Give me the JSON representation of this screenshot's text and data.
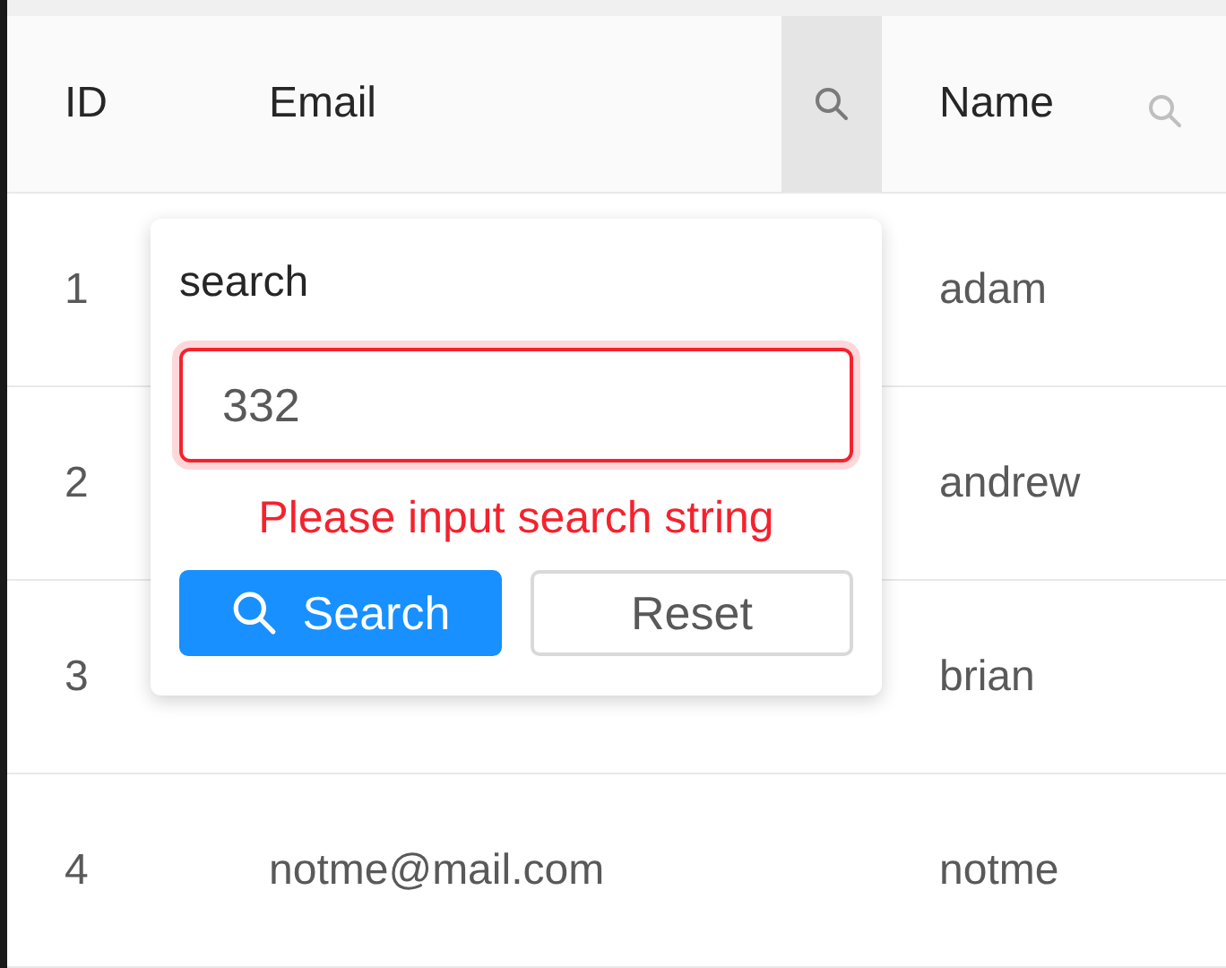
{
  "columns": [
    {
      "label": "ID"
    },
    {
      "label": "Email",
      "filter_active": true
    },
    {
      "label": "Name",
      "filter_active": false
    }
  ],
  "rows": [
    {
      "id": "1",
      "name": "adam"
    },
    {
      "id": "2",
      "name": "andrew"
    },
    {
      "id": "3",
      "name": "brian"
    },
    {
      "id": "4",
      "email": "notme@mail.com",
      "name": "notme"
    }
  ],
  "filter_popup": {
    "label": "search",
    "value": "332",
    "error": "Please input search string",
    "buttons": [
      {
        "label": "Search",
        "kind": "primary"
      },
      {
        "label": "Reset",
        "kind": "default"
      }
    ]
  }
}
